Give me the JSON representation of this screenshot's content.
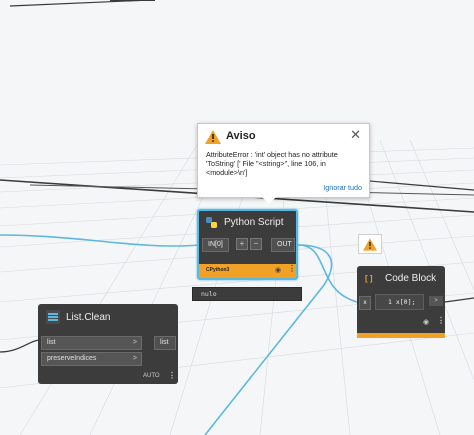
{
  "warning_popup": {
    "title": "Aviso",
    "message": "AttributeError : 'int' object has no attribute 'ToString' ['  File \"<string>\", line 106, in <module>\\n']",
    "dismiss_link": "Ignorar tudo"
  },
  "python_node": {
    "title": "Python Script",
    "input_port": "IN[0]",
    "add_label": "+",
    "remove_label": "−",
    "output_port": "OUT",
    "footer_label": "CPython3",
    "preview_value": "nulo"
  },
  "list_clean_node": {
    "title": "List.Clean",
    "inputs": [
      {
        "label": "list",
        "chevron": ">"
      },
      {
        "label": "preserveIndices",
        "chevron": ">"
      }
    ],
    "output_port": "list",
    "lacing": "AUTO"
  },
  "code_block_node": {
    "title": "Code Block",
    "input_port": "x",
    "code": "1 x[0];",
    "output_port": ">"
  },
  "icons": [
    "warning-icon",
    "close-icon",
    "python-icon",
    "list-icon",
    "code-block-icon",
    "eye-icon",
    "more-options-icon"
  ],
  "colors": {
    "selection_blue": "#5bb8e0",
    "warning_orange": "#f0a126",
    "node_dark": "#3c3c3c",
    "link_blue": "#1a6fc2"
  }
}
